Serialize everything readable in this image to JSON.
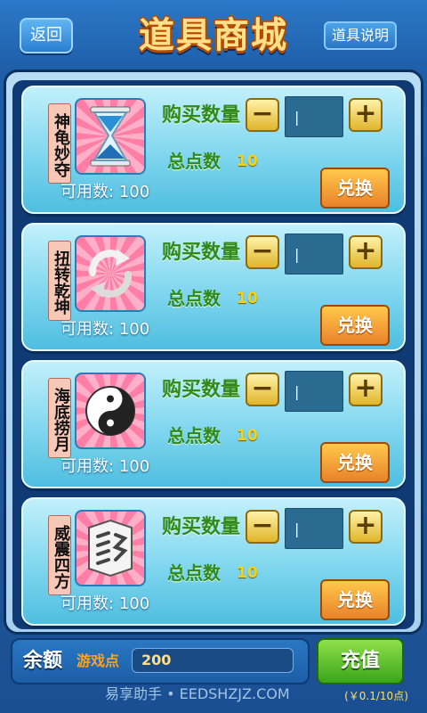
{
  "header": {
    "back_label": "返回",
    "title": "道具商城",
    "help_label": "道具说明"
  },
  "items": [
    {
      "name": "神龟妙夺",
      "icon": "hourglass-icon",
      "available": "可用数: 100",
      "qty_label": "购买数量",
      "qty_value": "|",
      "total_label": "总点数",
      "total_value": "10",
      "exchange_label": "兑换"
    },
    {
      "name": "扭转乾坤",
      "icon": "refresh-arrows-icon",
      "available": "可用数: 100",
      "qty_label": "购买数量",
      "qty_value": "|",
      "total_label": "总点数",
      "total_value": "10",
      "exchange_label": "兑换"
    },
    {
      "name": "海底捞月",
      "icon": "yin-yang-icon",
      "available": "可用数: 100",
      "qty_label": "购买数量",
      "qty_value": "|",
      "total_label": "总点数",
      "total_value": "10",
      "exchange_label": "兑换"
    },
    {
      "name": "威震四方",
      "icon": "mahjong-tile-icon",
      "available": "可用数: 100",
      "qty_label": "购买数量",
      "qty_value": "|",
      "total_label": "总点数",
      "total_value": "10",
      "exchange_label": "兑换"
    }
  ],
  "stepper": {
    "minus": "−",
    "plus": "+"
  },
  "bottom": {
    "balance_label": "余额",
    "points_label": "游戏点",
    "points_value": "200",
    "recharge_label": "充值"
  },
  "footer": {
    "watermark": "易享助手 • EEDSHZJZ.COM",
    "rate": "(￥0.1/10点)"
  }
}
